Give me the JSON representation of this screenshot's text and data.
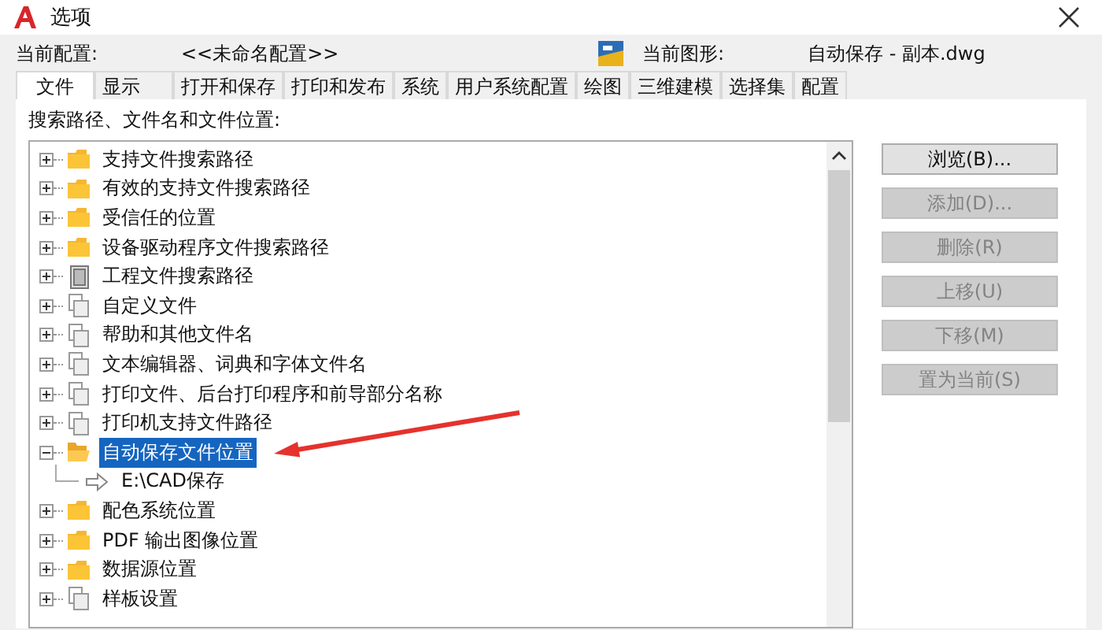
{
  "window": {
    "title": "选项"
  },
  "profile": {
    "label": "当前配置:",
    "value": "<<未命名配置>>"
  },
  "drawing": {
    "label": "当前图形:",
    "value": "自动保存 - 副本.dwg"
  },
  "tabs": [
    {
      "label": "文件",
      "selected": true
    },
    {
      "label": "显示",
      "selected": false
    },
    {
      "label": "打开和保存",
      "selected": false
    },
    {
      "label": "打印和发布",
      "selected": false
    },
    {
      "label": "系统",
      "selected": false
    },
    {
      "label": "用户系统配置",
      "selected": false
    },
    {
      "label": "绘图",
      "selected": false
    },
    {
      "label": "三维建模",
      "selected": false
    },
    {
      "label": "选择集",
      "selected": false
    },
    {
      "label": "配置",
      "selected": false
    }
  ],
  "tree_label": "搜索路径、文件名和文件位置:",
  "tree": [
    {
      "label": "支持文件搜索路径",
      "kind": "folder",
      "expanded": false,
      "selected": false
    },
    {
      "label": "有效的支持文件搜索路径",
      "kind": "folder",
      "expanded": false,
      "selected": false
    },
    {
      "label": "受信任的位置",
      "kind": "folder",
      "expanded": false,
      "selected": false
    },
    {
      "label": "设备驱动程序文件搜索路径",
      "kind": "folder",
      "expanded": false,
      "selected": false
    },
    {
      "label": "工程文件搜索路径",
      "kind": "project",
      "expanded": false,
      "selected": false
    },
    {
      "label": "自定义文件",
      "kind": "files",
      "expanded": false,
      "selected": false
    },
    {
      "label": "帮助和其他文件名",
      "kind": "files",
      "expanded": false,
      "selected": false
    },
    {
      "label": "文本编辑器、词典和字体文件名",
      "kind": "files",
      "expanded": false,
      "selected": false
    },
    {
      "label": "打印文件、后台打印程序和前导部分名称",
      "kind": "files",
      "expanded": false,
      "selected": false
    },
    {
      "label": "打印机支持文件路径",
      "kind": "files",
      "expanded": false,
      "selected": false
    },
    {
      "label": "自动保存文件位置",
      "kind": "folder",
      "expanded": true,
      "selected": true,
      "children": [
        {
          "label": "E:\\CAD保存",
          "kind": "path",
          "selected": false
        }
      ]
    },
    {
      "label": "配色系统位置",
      "kind": "folder",
      "expanded": false,
      "selected": false
    },
    {
      "label": "PDF 输出图像位置",
      "kind": "folder",
      "expanded": false,
      "selected": false
    },
    {
      "label": "数据源位置",
      "kind": "folder",
      "expanded": false,
      "selected": false
    },
    {
      "label": "样板设置",
      "kind": "files",
      "expanded": false,
      "selected": false
    }
  ],
  "buttons": [
    {
      "label": "浏览(B)...",
      "disabled": false
    },
    {
      "label": "添加(D)...",
      "disabled": true
    },
    {
      "label": "删除(R)",
      "disabled": true
    },
    {
      "label": "上移(U)",
      "disabled": true
    },
    {
      "label": "下移(M)",
      "disabled": true
    },
    {
      "label": "置为当前(S)",
      "disabled": true
    }
  ]
}
